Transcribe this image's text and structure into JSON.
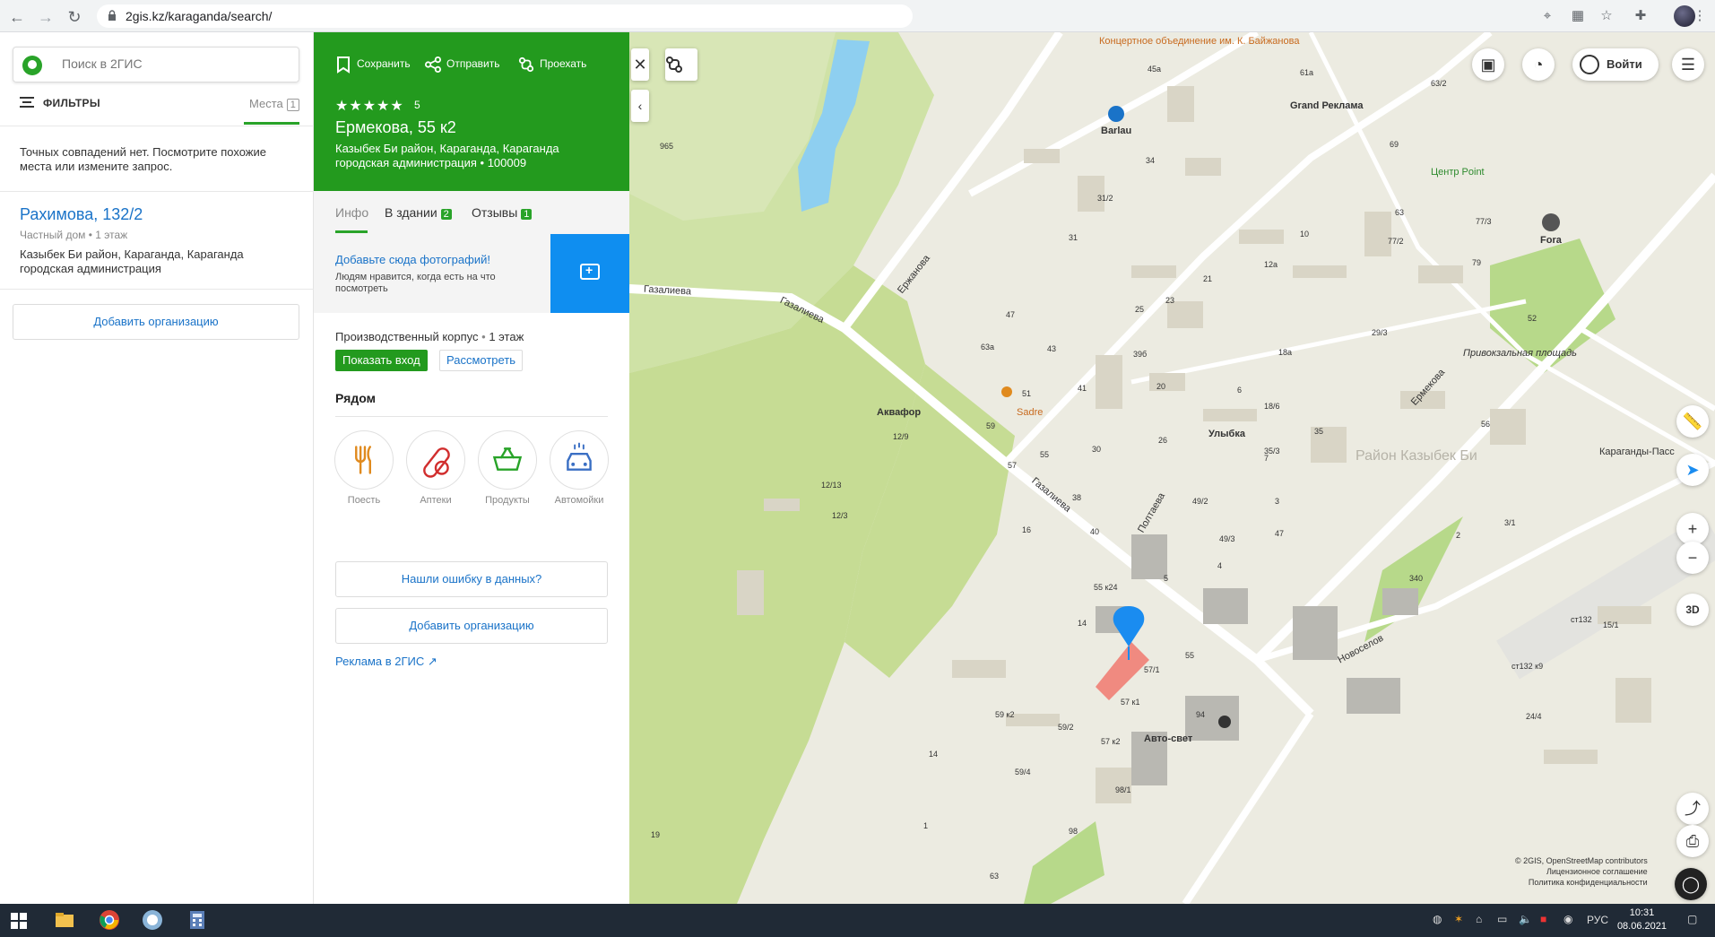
{
  "browser": {
    "url": "2gis.kz/karaganda/search/"
  },
  "left": {
    "search_placeholder": "Поиск в 2ГИС",
    "filters_label": "ФИЛЬТРЫ",
    "tab_label": "Места",
    "tab_count": "1",
    "no_match_text": "Точных совпадений нет. Посмотрите похожие места или измените запрос.",
    "result": {
      "title": "Рахимова, 132/2",
      "type": "Частный дом",
      "floors": "1 этаж",
      "address": "Казыбек Би район, Караганда, Караганда городская администрация"
    },
    "add_org": "Добавить организацию"
  },
  "card": {
    "actions": {
      "save": "Сохранить",
      "send": "Отправить",
      "route": "Проехать"
    },
    "stars": "★★★★★",
    "rating": "5",
    "title": "Ермекова, 55 к2",
    "address": "Казыбек Би район, Караганда, Караганда городская администрация • 100009",
    "tabs": {
      "info": "Инфо",
      "building": "В здании",
      "building_count": "2",
      "reviews": "Отзывы",
      "reviews_count": "1"
    },
    "photo": {
      "link": "Добавьте сюда фотографий!",
      "sub": "Людям нравится, когда есть на что посмотреть"
    },
    "building_type": "Производственный корпус",
    "building_floors": "1 этаж",
    "show_entrance": "Показать вход",
    "view": "Рассмотреть",
    "nearby_title": "Рядом",
    "nearby": [
      {
        "label": "Поесть",
        "icon": "fork-knife-icon",
        "color": "#e08a1e"
      },
      {
        "label": "Аптеки",
        "icon": "pill-icon",
        "color": "#d12e2e"
      },
      {
        "label": "Продукты",
        "icon": "basket-icon",
        "color": "#29a329"
      },
      {
        "label": "Автомойки",
        "icon": "car-wash-icon",
        "color": "#3a6fc4"
      }
    ],
    "report_error": "Нашли ошибку в данных?",
    "add_org": "Добавить организацию",
    "ads": "Реклама в 2ГИС ↗"
  },
  "map": {
    "login": "Войти",
    "btn_3d": "3D",
    "copyright_1": "© 2GIS, OpenStreetMap contributors",
    "copyright_2": "Лицензионное соглашение",
    "copyright_3": "Политика конфиденциальности",
    "labels": {
      "concert": "Концертное объединение им. К. Байжанова",
      "barlau": "Barlau",
      "grand": "Grand Реклама",
      "centr": "Центр Point",
      "fora": "Fora",
      "gazalieva1": "Газалиева",
      "gazalieva2": "Газалиева",
      "gazalieva3": "Газалиева",
      "erzhanova": "Ержанова",
      "akvafor": "Аквафор",
      "sadre": "Sadre",
      "ulybka": "Улыбка",
      "district": "Район Казыбек Би",
      "privokzal": "Привокзальная площадь",
      "ermekova": "Ермекова",
      "poltaveva": "Полтаева",
      "karaganda_pass": "Караганды-Пасс",
      "novoselov": "Новоселов",
      "avtosvet": "Авто-свет",
      "n45a": "45а",
      "n61a": "61а",
      "n63_2": "63/2",
      "n69": "69",
      "n34": "34",
      "n31_2": "31/2",
      "n31": "31",
      "n47": "47",
      "n63a": "63а",
      "n43": "43",
      "n39b": "39б",
      "n23": "23",
      "n25": "25",
      "n21": "21",
      "n12a": "12а",
      "n10": "10",
      "n77_2": "77/2",
      "n77_3": "77/3",
      "n29_3": "29/3",
      "n63": "63",
      "n79": "79",
      "n52": "52",
      "n51": "51",
      "n41": "41",
      "n20": "20",
      "n18a": "18а",
      "n18_6": "18/6",
      "n35": "35",
      "n35_3": "35/3",
      "n59": "59",
      "n55": "55",
      "n30": "30",
      "n26": "26",
      "n57": "57",
      "n38": "38",
      "n40": "40",
      "n49_2": "49/2",
      "n49_3": "49/3",
      "n47b": "47",
      "n3": "3",
      "n4": "4",
      "n5": "5",
      "n2": "2",
      "n3_1": "3/1",
      "n12_13": "12/13",
      "n12_3": "12/3",
      "n12_9": "12/9",
      "n16": "16",
      "n14": "14",
      "n55_24": "55 к24",
      "n57_1": "57/1",
      "n57k1": "57 к1",
      "n55b": "55",
      "n94": "94",
      "n59k2": "59 к2",
      "n59_2": "59/2",
      "n57k2": "57 к2",
      "n59_4": "59/4",
      "n98_1": "98/1",
      "n98": "98",
      "n1": "1",
      "n19": "19",
      "n63b": "63",
      "n14b": "14",
      "n340": "340",
      "n15_1": "15/1",
      "n132": "ст132",
      "n132k9": "ст132 к9",
      "n24_4": "24/4",
      "n965": "965",
      "n7": "7",
      "n6": "6",
      "n56": "56"
    }
  },
  "taskbar": {
    "lang": "РУС",
    "time": "10:31",
    "date": "08.06.2021"
  }
}
